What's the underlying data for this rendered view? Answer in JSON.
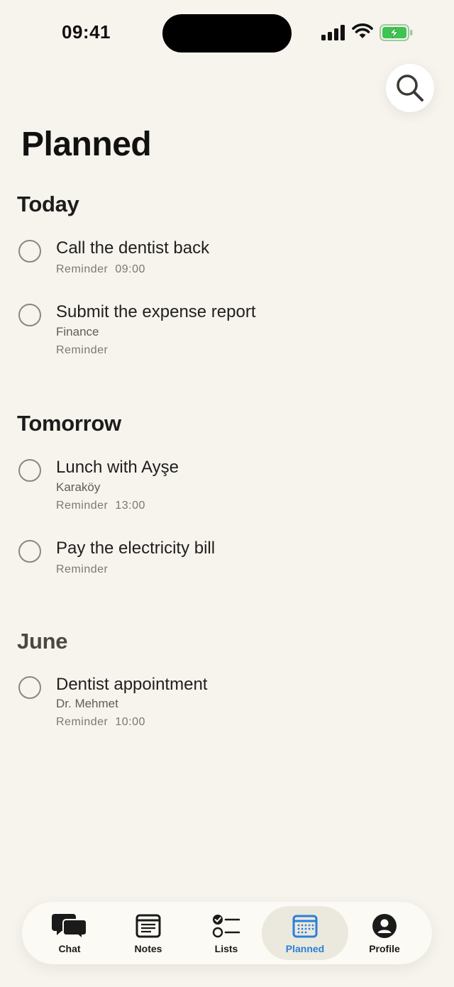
{
  "status_bar": {
    "time": "09:41",
    "icons": [
      "cellular-signal-icon",
      "wifi-icon",
      "battery-charging-icon"
    ]
  },
  "header": {
    "search_icon": "magnifier-icon",
    "title": "Planned"
  },
  "sections": [
    {
      "heading": "Today",
      "tasks": [
        {
          "title": "Call the dentist back",
          "subtitle": "",
          "meta": "Reminder",
          "time": "09:00"
        },
        {
          "title": "Submit the expense report",
          "subtitle": "Finance",
          "meta": "Reminder",
          "time": ""
        }
      ]
    },
    {
      "heading": "Tomorrow",
      "tasks": [
        {
          "title": "Lunch with Ayşe",
          "subtitle": "Karaköy",
          "meta": "Reminder",
          "time": "13:00"
        },
        {
          "title": "Pay the electricity bill",
          "subtitle": "",
          "meta": "Reminder",
          "time": ""
        }
      ]
    },
    {
      "heading": "June",
      "tasks": [
        {
          "title": "Dentist appointment",
          "subtitle": "Dr. Mehmet",
          "meta": "Reminder",
          "time": "10:00"
        }
      ]
    }
  ],
  "tab_bar": {
    "active": "Planned",
    "active_color": "#2b7fd6",
    "tabs": [
      {
        "label": "Chat",
        "icon": "chat-bubbles-icon"
      },
      {
        "label": "Notes",
        "icon": "note-icon"
      },
      {
        "label": "Lists",
        "icon": "checklist-icon"
      },
      {
        "label": "Planned",
        "icon": "calendar-icon"
      },
      {
        "label": "Profile",
        "icon": "person-icon"
      }
    ]
  }
}
